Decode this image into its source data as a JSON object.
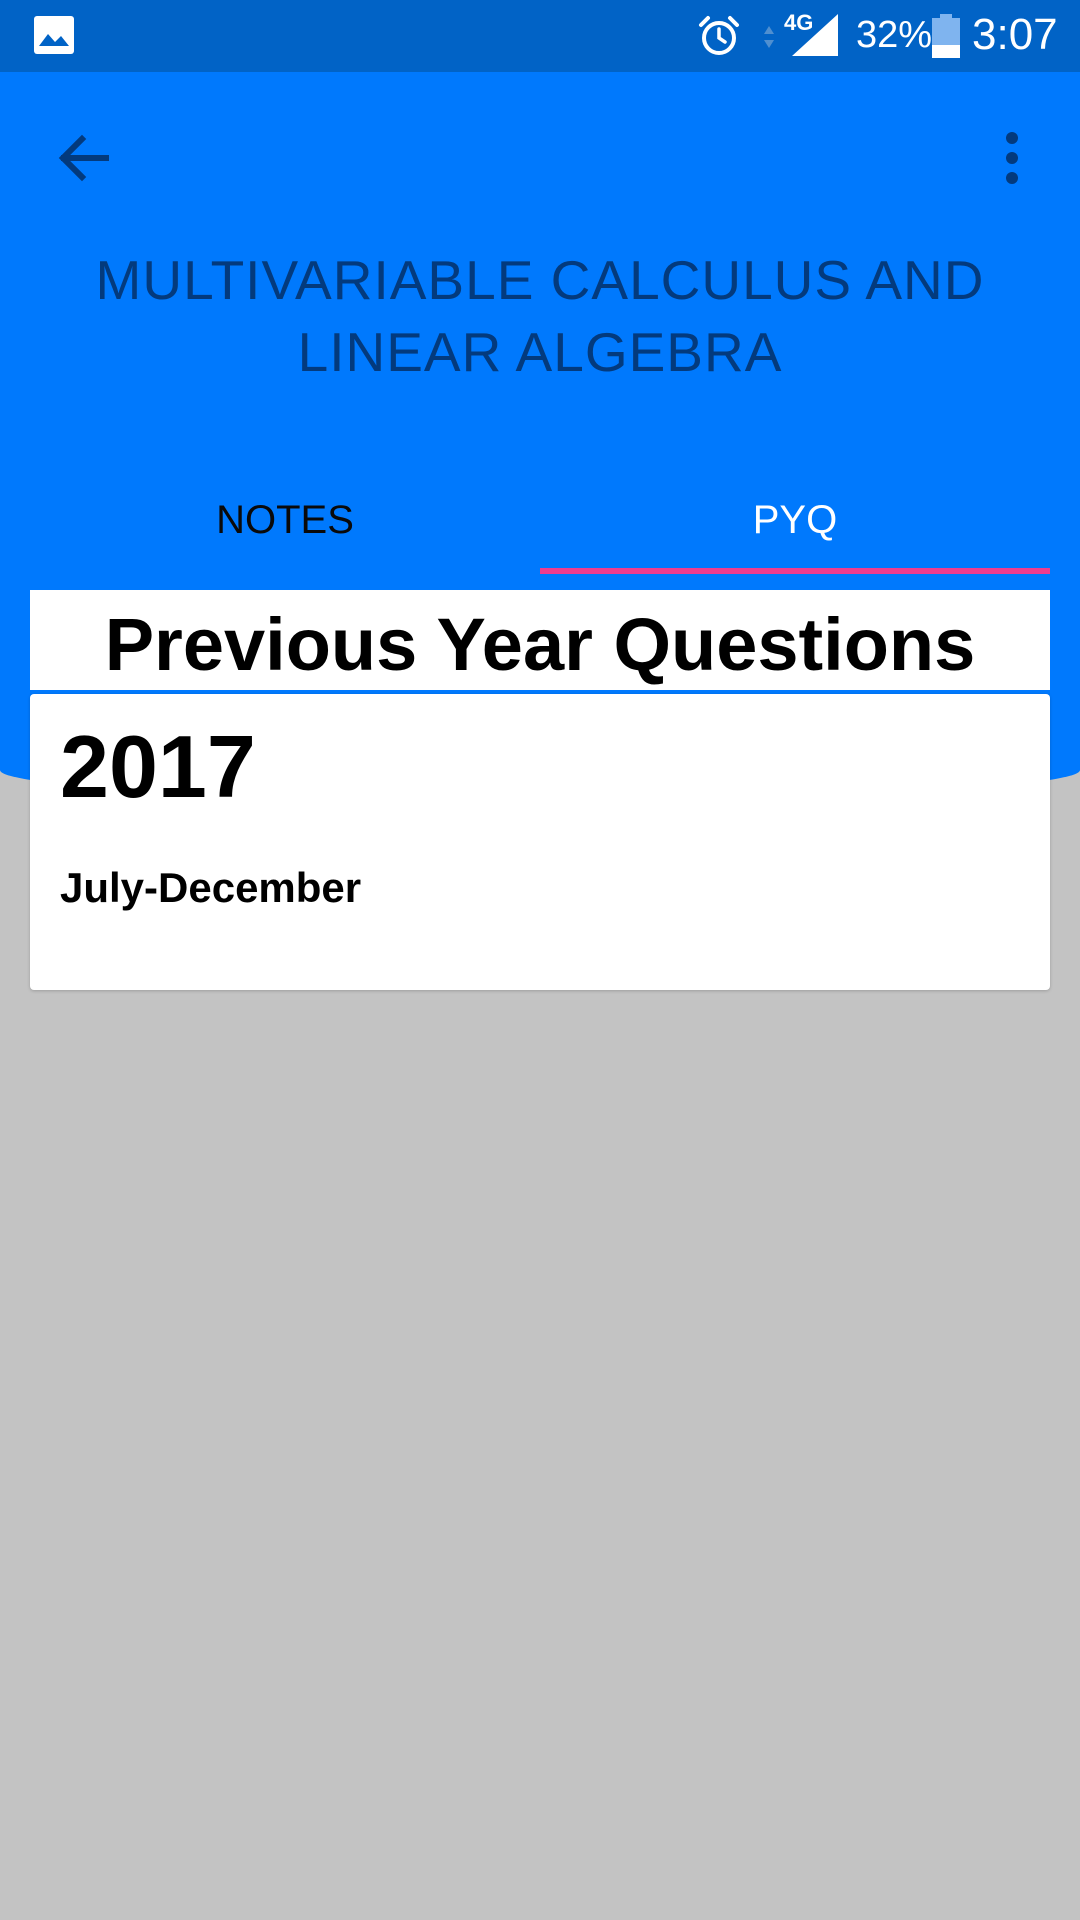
{
  "status_bar": {
    "network_type": "4G",
    "battery_percent": "32%",
    "battery_level": 0.32,
    "time": "3:07",
    "icons": [
      "gallery-icon",
      "alarm-icon",
      "data-arrows-icon",
      "signal-icon",
      "battery-icon"
    ]
  },
  "app_bar": {
    "title": "MULTIVARIABLE CALCULUS AND LINEAR ALGEBRA",
    "back_icon": "arrow-left-icon",
    "menu_icon": "more-vert-icon"
  },
  "tabs": [
    {
      "label": "NOTES",
      "selected": false
    },
    {
      "label": "PYQ",
      "selected": true
    }
  ],
  "section": {
    "title": "Previous Year Questions"
  },
  "cards": [
    {
      "year": "2017",
      "term": "July-December"
    }
  ],
  "colors": {
    "app_bar": "#0079fd",
    "status_bar": "#0163c6",
    "title_text": "#033a7d",
    "tab_indicator": "#f03c8f",
    "background": "#c3c3c3"
  }
}
